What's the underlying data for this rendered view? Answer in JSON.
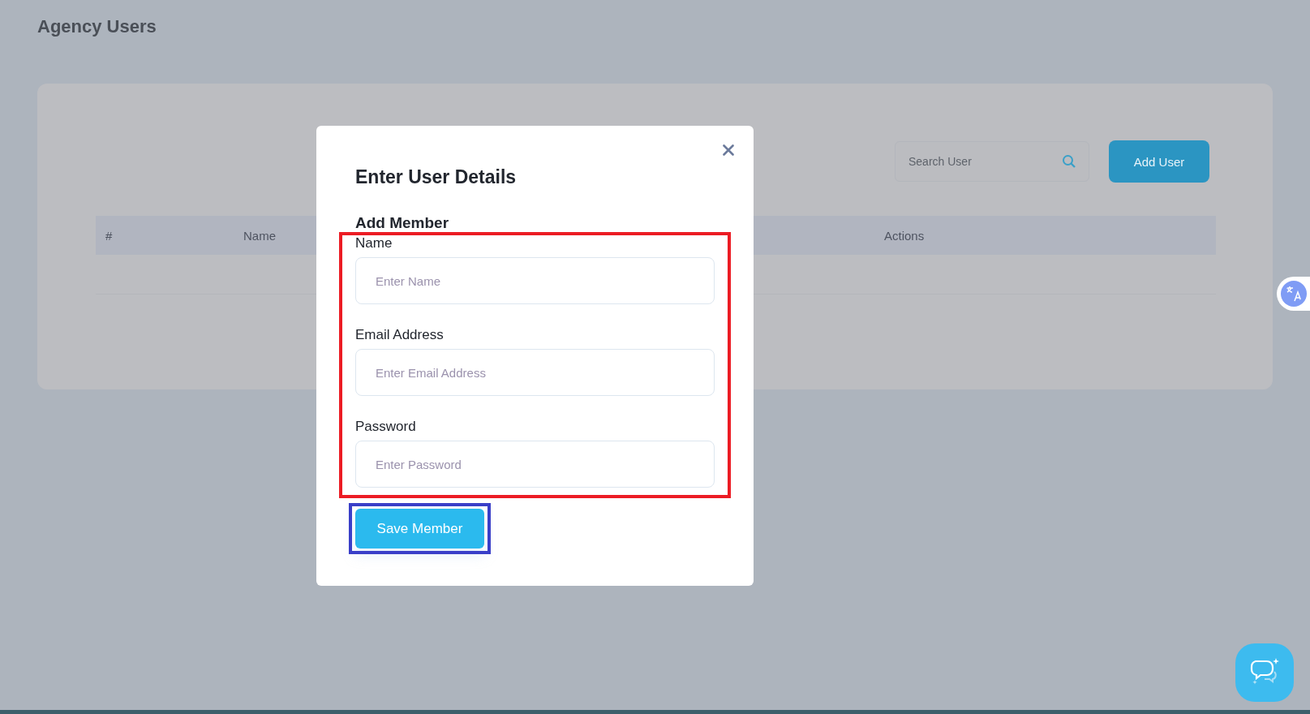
{
  "page": {
    "title": "Agency Users"
  },
  "toolbar": {
    "search": {
      "placeholder": "Search User"
    },
    "add_button": "Add User"
  },
  "table": {
    "columns": [
      "#",
      "Name",
      "Actions"
    ]
  },
  "modal": {
    "title": "Enter User Details",
    "section": "Add Member",
    "fields": [
      {
        "label": "Name",
        "placeholder": "Enter Name"
      },
      {
        "label": "Email Address",
        "placeholder": "Enter Email Address"
      },
      {
        "label": "Password",
        "placeholder": "Enter Password"
      }
    ],
    "save_button": "Save Member"
  }
}
